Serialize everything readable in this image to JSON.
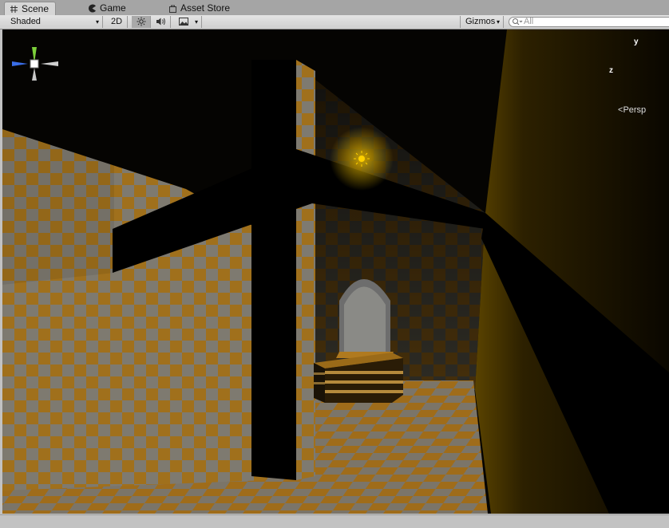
{
  "tabs": [
    {
      "label": "Scene",
      "icon": "hash-icon",
      "active": true
    },
    {
      "label": "Game",
      "icon": "pacman-icon",
      "active": false
    },
    {
      "label": "Asset Store",
      "icon": "bag-icon",
      "active": false
    }
  ],
  "toolbar": {
    "shading_mode": "Shaded",
    "mode_2d": "2D",
    "gizmos_label": "Gizmos",
    "search_placeholder": "All"
  },
  "scene_gizmo": {
    "y_label": "y",
    "z_label": "z",
    "projection": "Persp",
    "colors": {
      "y": "#7ccf3a",
      "z": "#3a6ee8",
      "x": "#d0d0d0"
    }
  },
  "colors": {
    "checker_orange": "#b07a1f",
    "checker_grey": "#8a8a80",
    "beam": "#000000",
    "light": "#ffd000"
  }
}
